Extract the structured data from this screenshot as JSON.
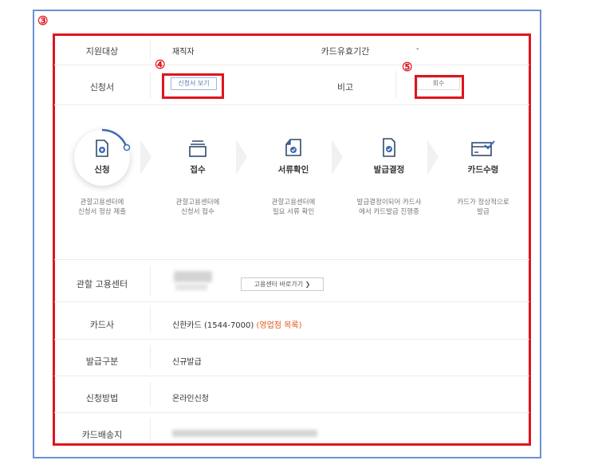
{
  "markers": {
    "m3": "③",
    "m4": "④",
    "m5": "⑤"
  },
  "top_table": {
    "row1": {
      "label1": "지원대상",
      "value1": "재직자",
      "label2": "카드유효기간",
      "value2": "-"
    },
    "row2": {
      "label1": "신청서",
      "view_button": "신청서 보기",
      "label2": "비고",
      "withdraw_button": "회수"
    }
  },
  "steps": [
    {
      "name": "신청",
      "desc1": "관할고용센터에",
      "desc2": "신청서 정상 제출",
      "icon": "document-upload-icon"
    },
    {
      "name": "접수",
      "desc1": "관할고용센터에",
      "desc2": "신청서 접수",
      "icon": "inbox-tray-icon"
    },
    {
      "name": "서류확인",
      "desc1": "관할고용센터에",
      "desc2": "필요 서류 확인",
      "icon": "document-check-icon"
    },
    {
      "name": "발급결정",
      "desc1": "발급결정이되어 카드사",
      "desc2": "에서 카드발급 진행중",
      "icon": "document-approved-icon"
    },
    {
      "name": "카드수령",
      "desc1": "카드가 정상적으로",
      "desc2": "발급",
      "icon": "card-received-icon"
    }
  ],
  "details": {
    "center": {
      "label": "관할 고용센터",
      "shortcut_button": "고용센터 바로가기 ❯"
    },
    "card_company": {
      "label": "카드사",
      "value": "신한카드 (1544-7000)",
      "branch_link": "(영업점 목록)"
    },
    "issue_type": {
      "label": "발급구분",
      "value": "신규발급"
    },
    "apply_method": {
      "label": "신청방법",
      "value": "온라인신청"
    },
    "delivery": {
      "label": "카드배송지"
    }
  },
  "colors": {
    "accent_red": "#e0141e",
    "frame_blue": "#6d8fd6",
    "link_orange": "#e05a1a",
    "active_ring": "#3a6bb5"
  }
}
